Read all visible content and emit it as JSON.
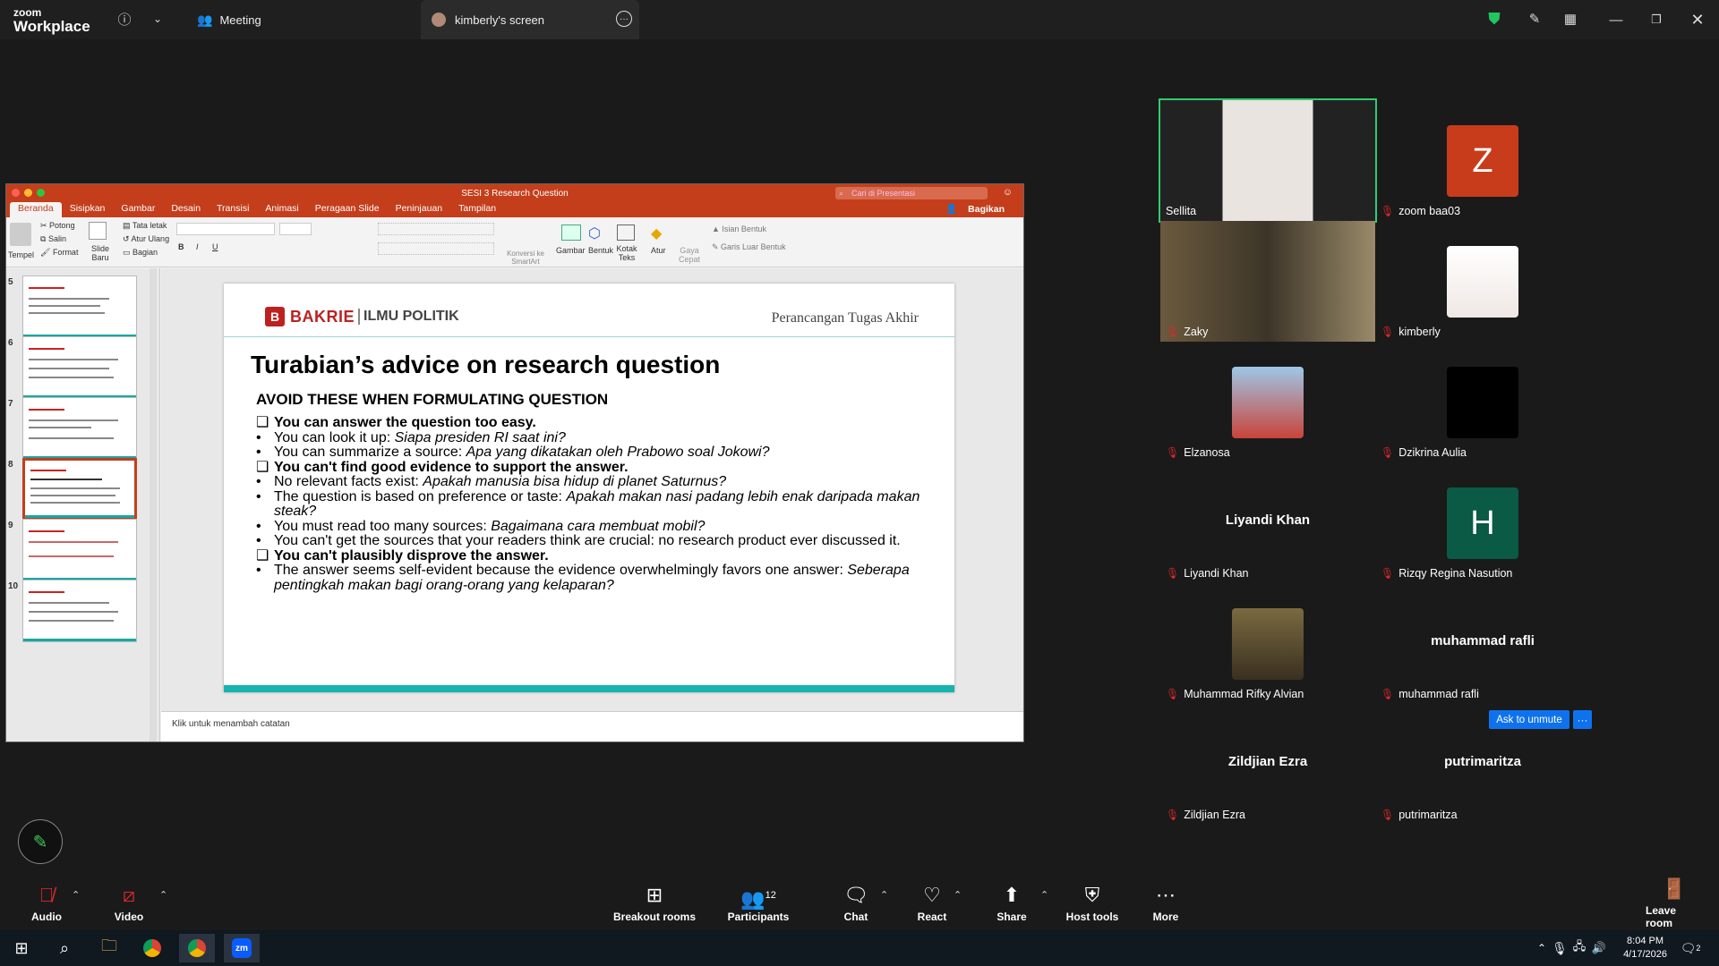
{
  "app": {
    "brand_top": "zoom",
    "brand_bottom": "Workplace"
  },
  "tabs": {
    "meeting": "Meeting",
    "screen": "kimberly's screen"
  },
  "icons": {
    "info": "info-icon",
    "chevron": "chevron-down-icon",
    "shield": "shield-icon",
    "pen": "pen-icon",
    "layout": "layout-icon"
  },
  "ppt": {
    "title": "SESI 3 Research Question",
    "search_placeholder": "Cari di Presentasi",
    "share": "Bagikan",
    "tabs": [
      "Beranda",
      "Sisipkan",
      "Gambar",
      "Desain",
      "Transisi",
      "Animasi",
      "Peragaan Slide",
      "Peninjauan",
      "Tampilan"
    ],
    "ribbon": {
      "paste": "Tempel",
      "cut": "Potong",
      "copy": "Salin",
      "format": "Format",
      "new_slide": "Slide Baru",
      "layout": "Tata letak",
      "reset": "Atur Ulang",
      "section": "Bagian",
      "convert_smartart": "Konversi ke SmartArt",
      "picture": "Gambar",
      "shapes": "Bentuk",
      "textbox": "Kotak Teks",
      "arrange": "Atur",
      "quick_styles": "Gaya Cepat",
      "shape_fill": "Isian Bentuk",
      "shape_outline": "Garis Luar Bentuk"
    },
    "thumb_numbers": [
      "5",
      "6",
      "7",
      "8",
      "9",
      "10"
    ],
    "notes": "Klik untuk menambah catatan"
  },
  "slide": {
    "logo_crest": "B",
    "logo_univ": "BAKRIE",
    "logo_dept": "ILMU POLITIK",
    "course": "Perancangan Tugas Akhir",
    "title": "Turabian’s advice on research question",
    "subtitle": "AVOID THESE WHEN FORMULATING QUESTION",
    "items": [
      {
        "mark": "❑",
        "bold": "You can answer the question too easy.",
        "plain": "",
        "ital": ""
      },
      {
        "mark": "•",
        "bold": "",
        "plain": "You can look it up: ",
        "ital": "Siapa presiden RI saat ini?"
      },
      {
        "mark": "•",
        "bold": "",
        "plain": "You can summarize a source: ",
        "ital": "Apa yang dikatakan oleh Prabowo soal Jokowi?"
      },
      {
        "mark": "❑",
        "bold": "You can't find good evidence to support the answer.",
        "plain": "",
        "ital": ""
      },
      {
        "mark": "•",
        "bold": "",
        "plain": "No relevant facts exist: ",
        "ital": "Apakah manusia bisa hidup di planet Saturnus?"
      },
      {
        "mark": "•",
        "bold": "",
        "plain": "The question is based on preference or taste: ",
        "ital": "Apakah makan nasi padang lebih enak daripada makan steak?"
      },
      {
        "mark": "•",
        "bold": "",
        "plain": "You must read too many sources: ",
        "ital": "Bagaimana cara membuat mobil?"
      },
      {
        "mark": "•",
        "bold": "",
        "plain": "You can't get the sources that your readers think are crucial: no research product ever discussed it.",
        "ital": ""
      },
      {
        "mark": "❑",
        "bold": "You can't plausibly disprove the answer.",
        "plain": "",
        "ital": ""
      },
      {
        "mark": "•",
        "bold": "",
        "plain": "The answer seems self-evident because the evidence overwhelmingly favors one answer: ",
        "ital": "Seberapa pentingkah makan bagi orang-orang yang kelaparan?"
      }
    ]
  },
  "participants": [
    {
      "name": "Sellita",
      "muted": false,
      "type": "video"
    },
    {
      "name": "zoom baa03",
      "muted": true,
      "type": "letter",
      "letter": "Z",
      "color": "#c83c1b"
    },
    {
      "name": "Zaky",
      "muted": true,
      "type": "video"
    },
    {
      "name": "kimberly",
      "muted": true,
      "type": "photo"
    },
    {
      "name": "Elzanosa",
      "muted": true,
      "type": "photo"
    },
    {
      "name": "Dzikrina Aulia",
      "muted": true,
      "type": "black"
    },
    {
      "name": "Liyandi Khan",
      "muted": true,
      "type": "name",
      "big": "Liyandi Khan"
    },
    {
      "name": "Rizqy Regina Nasution",
      "muted": true,
      "type": "letter",
      "letter": "H",
      "color": "#0a5a45"
    },
    {
      "name": "Muhammad Rifky Alvian",
      "muted": true,
      "type": "photo"
    },
    {
      "name": "muhammad rafli",
      "muted": true,
      "type": "name",
      "big": "muhammad rafli"
    },
    {
      "name": "Zildjian Ezra",
      "muted": true,
      "type": "name",
      "big": "Zildjian Ezra"
    },
    {
      "name": "putrimaritza",
      "muted": true,
      "type": "name",
      "big": "putrimaritza"
    }
  ],
  "unmute": {
    "label": "Ask to unmute",
    "more": "···"
  },
  "controls": {
    "audio": "Audio",
    "video": "Video",
    "breakout": "Breakout rooms",
    "participants": "Participants",
    "participants_count": "12",
    "chat": "Chat",
    "react": "React",
    "share": "Share",
    "host_tools": "Host tools",
    "more": "More",
    "leave": "Leave room"
  },
  "taskbar": {
    "time": "8:04 PM",
    "date": "4/17/2026",
    "notif": "2"
  }
}
